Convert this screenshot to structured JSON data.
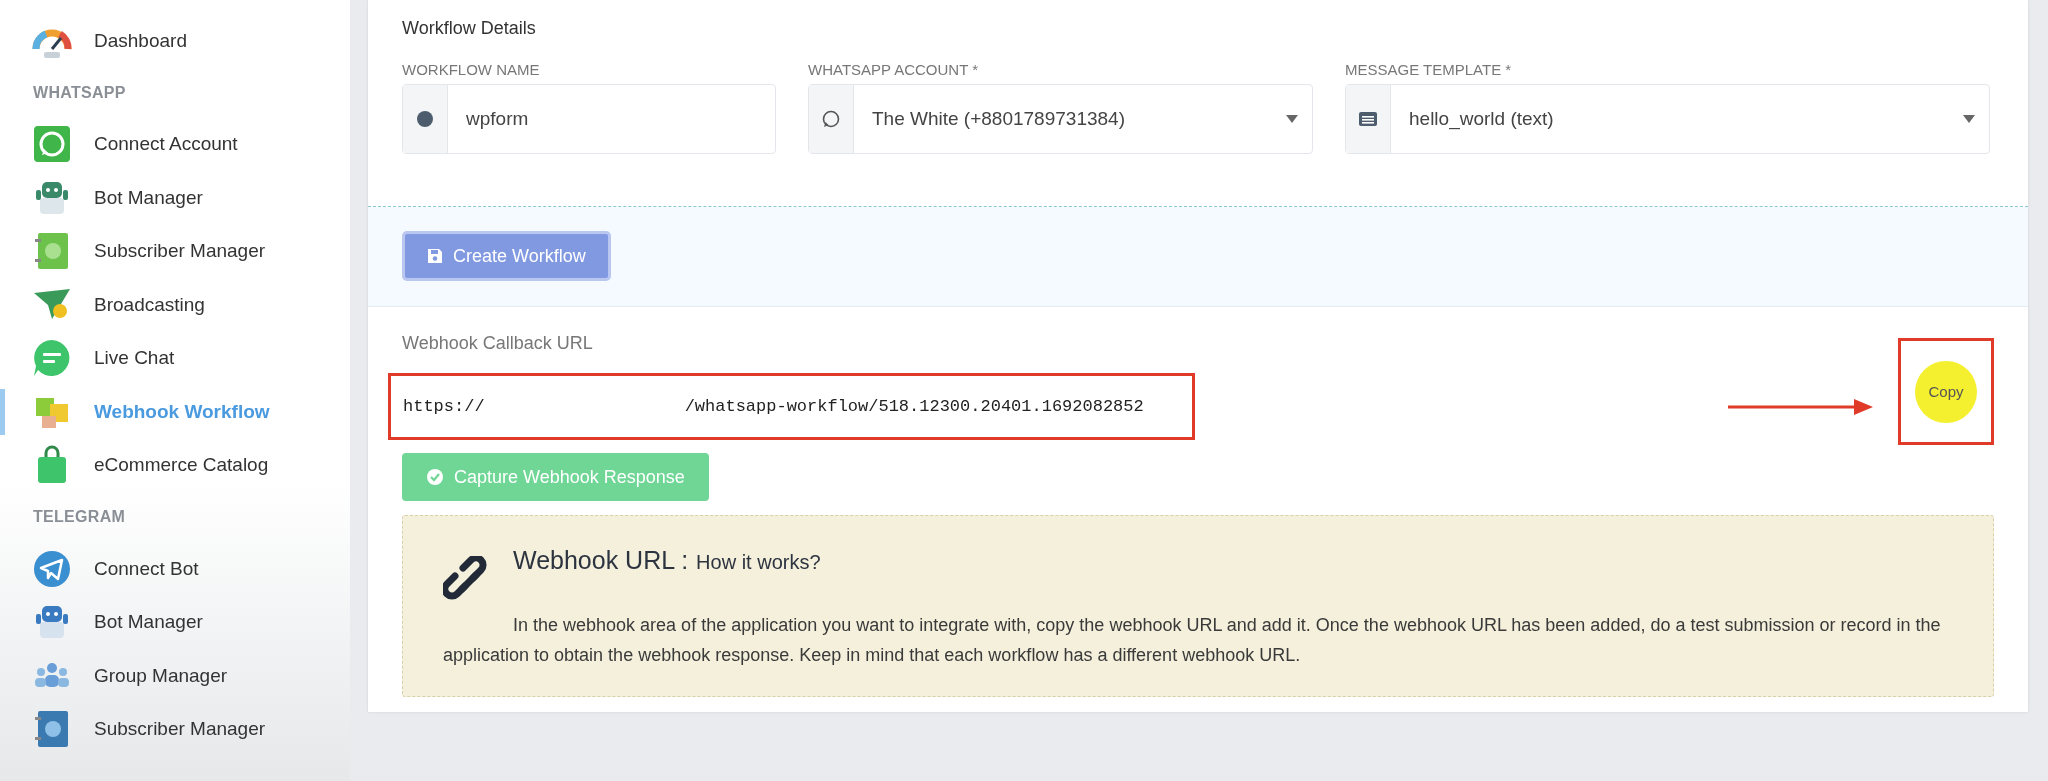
{
  "sidebar": {
    "items": [
      {
        "kind": "item",
        "label": "Dashboard",
        "selected": false
      },
      {
        "kind": "header",
        "label": "WHATSAPP"
      },
      {
        "kind": "item",
        "label": "Connect Account",
        "selected": false
      },
      {
        "kind": "item",
        "label": "Bot Manager",
        "selected": false
      },
      {
        "kind": "item",
        "label": "Subscriber Manager",
        "selected": false
      },
      {
        "kind": "item",
        "label": "Broadcasting",
        "selected": false
      },
      {
        "kind": "item",
        "label": "Live Chat",
        "selected": false
      },
      {
        "kind": "item",
        "label": "Webhook Workflow",
        "selected": true
      },
      {
        "kind": "item",
        "label": "eCommerce Catalog",
        "selected": false
      },
      {
        "kind": "header",
        "label": "TELEGRAM"
      },
      {
        "kind": "item",
        "label": "Connect Bot",
        "selected": false
      },
      {
        "kind": "item",
        "label": "Bot Manager",
        "selected": false
      },
      {
        "kind": "item",
        "label": "Group Manager",
        "selected": false
      },
      {
        "kind": "item",
        "label": "Subscriber Manager",
        "selected": false
      }
    ]
  },
  "details": {
    "title": "Workflow Details",
    "fields": [
      {
        "label": "WORKFLOW NAME",
        "value": "wpform",
        "kind": "text"
      },
      {
        "label": "WHATSAPP ACCOUNT *",
        "value": "The White (+8801789731384)",
        "kind": "select"
      },
      {
        "label": "MESSAGE TEMPLATE *",
        "value": "hello_world (text)",
        "kind": "select"
      }
    ]
  },
  "create_button": "Create Workflow",
  "webhook": {
    "title": "Webhook Callback URL",
    "url_start": "https://",
    "url_end": "/whatsapp-workflow/518.12300.20401.1692082852",
    "copy_button": "Copy",
    "capture_button": "Capture Webhook Response",
    "info": {
      "title": "Webhook URL :",
      "subtitle": "How it works?",
      "text": "In the webhook area of the application you want to integrate with, copy the webhook URL and add it. Once the webhook URL has been added, do a test submission or record in the application to obtain the webhook response. Keep in mind that each workflow has a different webhook URL."
    }
  }
}
